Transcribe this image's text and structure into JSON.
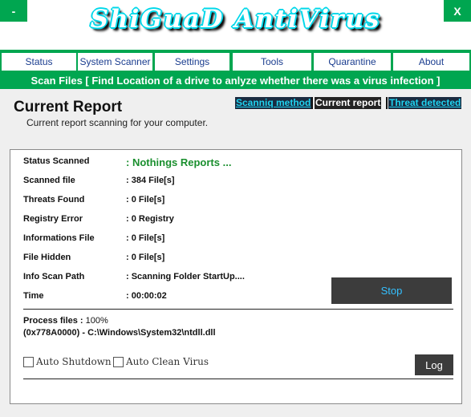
{
  "titlebar": {
    "minimize_label": "-",
    "close_label": "X",
    "logo_text": "ShiGuaD AntiVirus"
  },
  "tabs": [
    {
      "label": "Status"
    },
    {
      "label": "System Scanner"
    },
    {
      "label": "Settings"
    },
    {
      "label": "Tools"
    },
    {
      "label": "Quarantine"
    },
    {
      "label": "About"
    }
  ],
  "scan_banner": "Scan Files [ Find Location of a drive to anlyze whether there was a virus infection ]",
  "report": {
    "title": "Current Report",
    "subtitle": "Current report scanning for your computer.",
    "links": {
      "scan_method": "Scanniq method",
      "current_report": "Current report",
      "threat_detected": "Threat detected"
    }
  },
  "stats": [
    {
      "label": "Status Scanned",
      "value": ": Nothings Reports ..."
    },
    {
      "label": "Scanned file",
      "value": ": 384 File[s]"
    },
    {
      "label": "Threats Found",
      "value": ": 0 File[s]"
    },
    {
      "label": "Registry Error",
      "value": ": 0 Registry"
    },
    {
      "label": "Informations File",
      "value": ": 0 File[s]"
    },
    {
      "label": "File Hidden",
      "value": ": 0 File[s]"
    },
    {
      "label": "Info Scan Path",
      "value": ": Scanning Folder StartUp...."
    },
    {
      "label": "Time",
      "value": ": 00:00:02"
    }
  ],
  "stop_label": "Stop",
  "process": {
    "label": "Process files :",
    "percent": "100%",
    "path": "(0x778A0000) - C:\\Windows\\System32\\ntdll.dll"
  },
  "options": {
    "auto_shutdown": "Auto Shutdown",
    "auto_clean": "Auto Clean Virus"
  },
  "log_label": "Log"
}
